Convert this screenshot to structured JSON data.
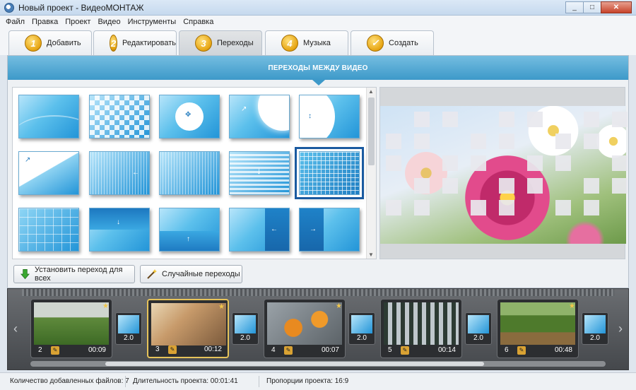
{
  "window": {
    "title": "Новый проект - ВидеоМОНТАЖ"
  },
  "menu": [
    "Файл",
    "Правка",
    "Проект",
    "Видео",
    "Инструменты",
    "Справка"
  ],
  "tabs": [
    {
      "num": "1",
      "label": "Добавить"
    },
    {
      "num": "2",
      "label": "Редактировать"
    },
    {
      "num": "3",
      "label": "Переходы"
    },
    {
      "num": "4",
      "label": "Музыка"
    },
    {
      "num": "",
      "label": "Создать"
    }
  ],
  "section": {
    "header": "ПЕРЕХОДЫ МЕЖДУ ВИДЕО"
  },
  "actions": {
    "apply_all": "Установить переход для всех",
    "random": "Случайные переходы"
  },
  "clips": [
    {
      "num": "2",
      "duration": "00:09"
    },
    {
      "num": "3",
      "duration": "00:12"
    },
    {
      "num": "4",
      "duration": "00:07"
    },
    {
      "num": "5",
      "duration": "00:14"
    },
    {
      "num": "6",
      "duration": "00:48"
    }
  ],
  "transitions": [
    "2.0",
    "2.0",
    "2.0",
    "2.0",
    "2.0"
  ],
  "status": {
    "files": "Количество добавленных файлов: 7",
    "duration": "Длительность проекта: 00:01:41",
    "ratio": "Пропорции проекта: 16:9"
  },
  "colors": {
    "accent": "#3d99c9",
    "tab_badge": "#e6a411",
    "selected_clip": "#e6c35a"
  }
}
